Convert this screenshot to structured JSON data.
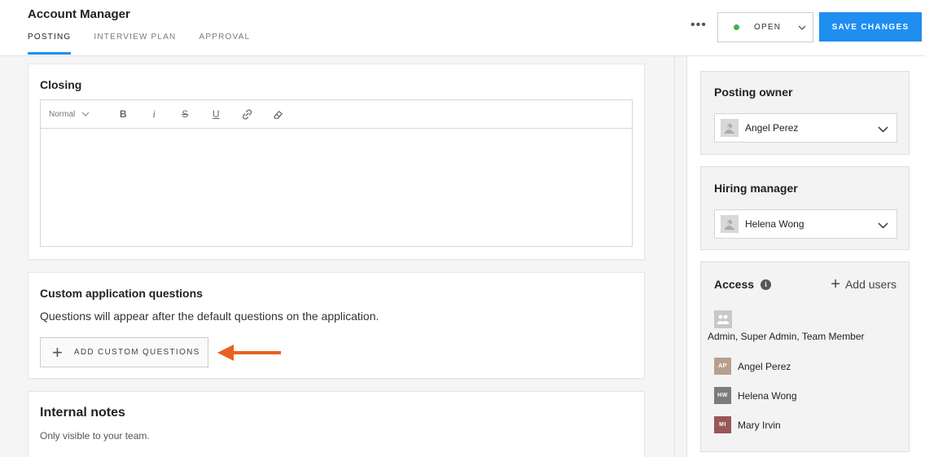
{
  "header": {
    "title": "Account Manager",
    "tabs": [
      {
        "label": "POSTING"
      },
      {
        "label": "INTERVIEW PLAN"
      },
      {
        "label": "APPROVAL"
      }
    ],
    "more_label": "•••",
    "status": {
      "label": "OPEN",
      "dot_color": "#3ab54a"
    },
    "save_label": "SAVE CHANGES",
    "accent": "#1f8ef1"
  },
  "closing": {
    "title": "Closing",
    "toolbar": {
      "format": "Normal",
      "buttons": [
        "B",
        "i",
        "S",
        "U"
      ]
    }
  },
  "custom_questions": {
    "title": "Custom application questions",
    "description": "Questions will appear after the default questions on the application.",
    "add_label": "ADD CUSTOM QUESTIONS",
    "arrow_color": "#e8611f"
  },
  "internal_notes": {
    "title": "Internal notes",
    "description": "Only visible to your team."
  },
  "sidebar": {
    "posting_owner": {
      "title": "Posting owner",
      "value": "Angel Perez"
    },
    "hiring_manager": {
      "title": "Hiring manager",
      "value": "Helena Wong"
    },
    "access": {
      "title": "Access",
      "add_label": "Add users",
      "roles": "Admin, Super Admin, Team Member",
      "users": [
        {
          "initials": "AP",
          "name": "Angel Perez",
          "color": "#b9a08c"
        },
        {
          "initials": "HW",
          "name": "Helena Wong",
          "color": "#7c7c7c"
        },
        {
          "initials": "MI",
          "name": "Mary Irvin",
          "color": "#9a5656"
        }
      ]
    }
  }
}
